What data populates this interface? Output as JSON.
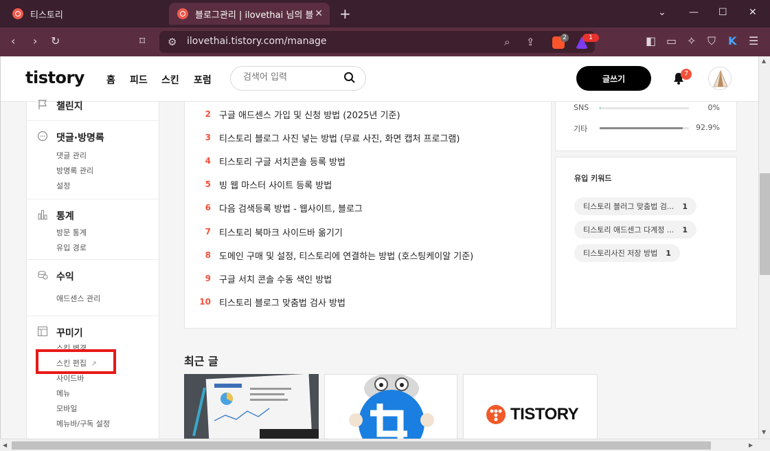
{
  "browser": {
    "tabs": [
      {
        "title": "티스토리"
      },
      {
        "title": "블로그관리 | ilovethai 님의 블"
      }
    ],
    "url": "ilovethai.tistory.com/manage",
    "brave_badge_count": "2",
    "rewards_badge_count": "1"
  },
  "header": {
    "logo": "tistory",
    "nav": [
      "홈",
      "피드",
      "스킨",
      "포럼"
    ],
    "search_placeholder": "검색어 입력",
    "write_button": "글쓰기",
    "notification_count": "7"
  },
  "sidebar": {
    "sections": [
      {
        "title": "챌린지",
        "links": []
      },
      {
        "title": "댓글·방명록",
        "links": [
          "댓글 관리",
          "방명록 관리",
          "설정"
        ]
      },
      {
        "title": "통계",
        "links": [
          "방문 통계",
          "유입 경로"
        ]
      },
      {
        "title": "수익",
        "links": [
          "애드센스 관리"
        ]
      },
      {
        "title": "꾸미기",
        "links": [
          "스킨 변경",
          "스킨 편집",
          "사이드바",
          "메뉴",
          "모바일",
          "메뉴바/구독 설정"
        ]
      }
    ]
  },
  "popular_posts": [
    {
      "rank": "2",
      "title": "구글 애드센스 가입 및 신청 방법 (2025년 기준)"
    },
    {
      "rank": "3",
      "title": "티스토리 블로그 사진 넣는 방법 (무료 사진, 화면 캡처 프로그램)"
    },
    {
      "rank": "4",
      "title": "티스토리 구글 서치콘솔 등록 방법"
    },
    {
      "rank": "5",
      "title": "빙 웹 마스터 사이트 등록 방법"
    },
    {
      "rank": "6",
      "title": "다음 검색등록 방법 - 웹사이트, 블로그"
    },
    {
      "rank": "7",
      "title": "티스토리 북마크 사이드바 옮기기"
    },
    {
      "rank": "8",
      "title": "도메인 구매 및 설정, 티스토리에 연결하는 방법 (호스팅케이알 기준)"
    },
    {
      "rank": "9",
      "title": "구글 서치 콘솔 수동 색인 방법"
    },
    {
      "rank": "10",
      "title": "티스토리 블로그 맞춤법 검사 방법"
    }
  ],
  "referrer_stats": [
    {
      "label": "SNS",
      "value": "0%",
      "fraction": 0.005
    },
    {
      "label": "기타",
      "value": "92.9%",
      "fraction": 0.929
    }
  ],
  "keywords": {
    "title": "유입 키워드",
    "items": [
      {
        "text": "티스토리 블러그 맞춤법 검...",
        "count": "1"
      },
      {
        "text": "티스토리 애드센그 다계정 ...",
        "count": "1"
      },
      {
        "text": "티스토리사진 저장 방법",
        "count": "1"
      }
    ]
  },
  "recent": {
    "title": "최근 글",
    "third_thumb_text": "TISTORY"
  },
  "colors": {
    "accent": "#f3513b",
    "highlight": "#e81818",
    "browser_frame": "#3a1f2e"
  }
}
